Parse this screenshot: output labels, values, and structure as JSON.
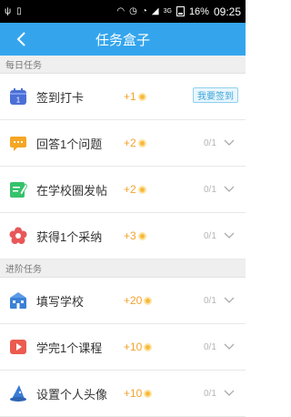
{
  "status_bar": {
    "left_icons": [
      "usb-icon",
      "vibrate-icon"
    ],
    "signal_label": "3G",
    "battery": "16%",
    "time": "09:25"
  },
  "header": {
    "title": "任务盒子"
  },
  "sections": [
    {
      "title": "每日任务",
      "tasks": [
        {
          "label": "签到打卡",
          "reward": "+1",
          "action": "我要签到",
          "icon": "calendar-icon",
          "color": "#4b6fd6"
        },
        {
          "label": "回答1个问题",
          "reward": "+2",
          "progress": "0/1",
          "icon": "chat-bubble-icon",
          "color": "#f5a623"
        },
        {
          "label": "在学校圈发帖",
          "reward": "+2",
          "progress": "0/1",
          "icon": "edit-post-icon",
          "color": "#35c26b"
        },
        {
          "label": "获得1个采纳",
          "reward": "+3",
          "progress": "0/1",
          "icon": "flower-icon",
          "color": "#e8575a"
        }
      ]
    },
    {
      "title": "进阶任务",
      "tasks": [
        {
          "label": "填写学校",
          "reward": "+20",
          "progress": "0/1",
          "icon": "school-icon",
          "color": "#3b82d6"
        },
        {
          "label": "学完1个课程",
          "reward": "+10",
          "progress": "0/1",
          "icon": "play-icon",
          "color": "#ec5b4f"
        },
        {
          "label": "设置个人头像",
          "reward": "+10",
          "progress": "0/1",
          "icon": "wizard-hat-icon",
          "color": "#3a7bd5"
        }
      ]
    }
  ],
  "colors": {
    "primary": "#34a5ed",
    "reward": "#f2a22e"
  }
}
